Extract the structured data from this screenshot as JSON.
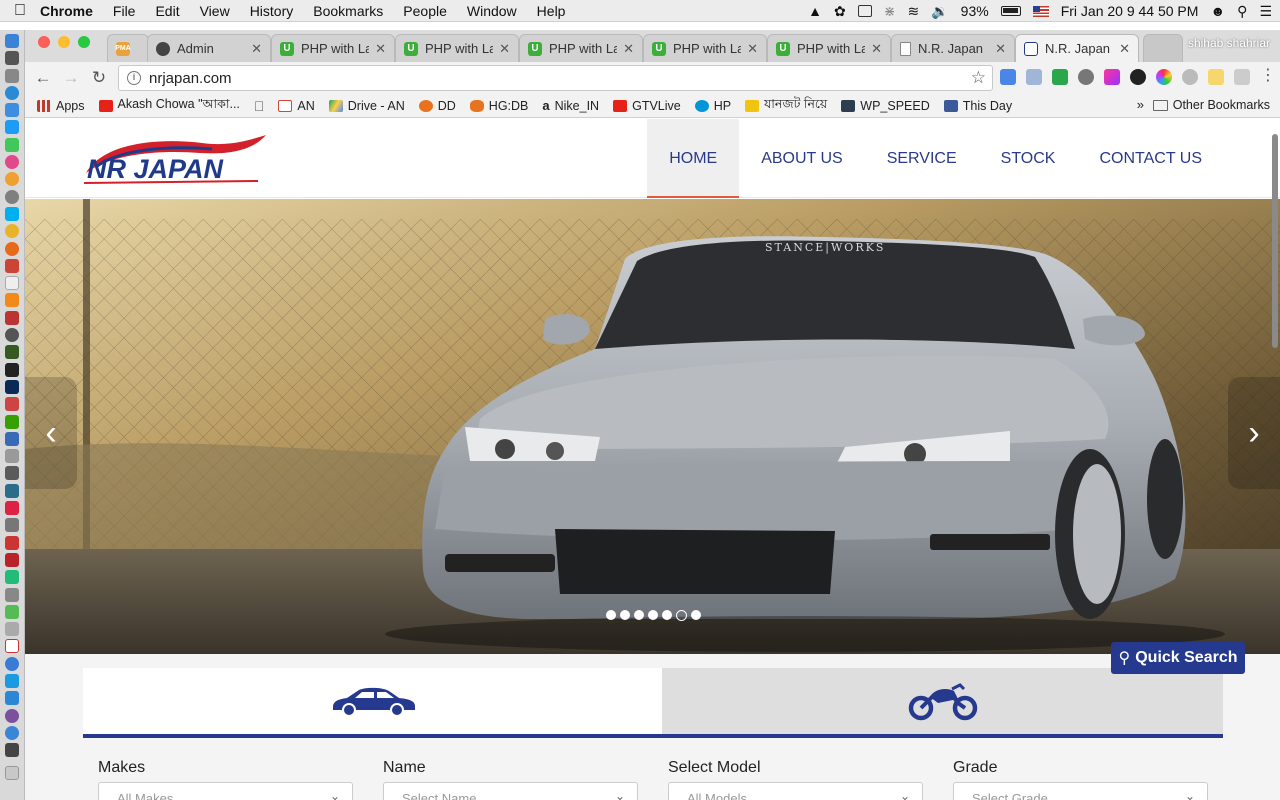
{
  "menubar": {
    "app": "Chrome",
    "items": [
      "File",
      "Edit",
      "View",
      "History",
      "Bookmarks",
      "People",
      "Window",
      "Help"
    ],
    "battery": "93%",
    "clock": "Fri Jan 20  9 44 50 PM"
  },
  "browser": {
    "tabs": [
      {
        "title": "",
        "favicon": "pma-icon",
        "color": "#e8a33c"
      },
      {
        "title": "Admin",
        "favicon": "github-icon",
        "color": "#444444"
      },
      {
        "title": "PHP with La",
        "favicon": "udemy-icon",
        "color": "#3cae3a"
      },
      {
        "title": "PHP with La",
        "favicon": "udemy-icon",
        "color": "#3cae3a"
      },
      {
        "title": "PHP with La",
        "favicon": "udemy-icon",
        "color": "#3cae3a"
      },
      {
        "title": "PHP with La",
        "favicon": "udemy-icon",
        "color": "#3cae3a"
      },
      {
        "title": "PHP with La",
        "favicon": "udemy-icon",
        "color": "#3cae3a"
      },
      {
        "title": "N.R. Japan",
        "favicon": "document-icon",
        "color": "#888888"
      },
      {
        "title": "N.R. Japan -",
        "favicon": "nrjapan-icon",
        "color": "#1f3a8a"
      }
    ],
    "profile_name": "shihab shahriar",
    "url": "nrjapan.com",
    "bookmarks": [
      {
        "label": "Apps",
        "icon": "apps-grid-icon",
        "color": "#c0392b"
      },
      {
        "label": "Akash Chowa \"আকা...",
        "icon": "youtube-icon",
        "color": "#e62117"
      },
      {
        "label": "",
        "icon": "apple-icon",
        "color": "#555555"
      },
      {
        "label": "AN",
        "icon": "gmail-icon",
        "color": "#d44638"
      },
      {
        "label": "Drive - AN",
        "icon": "drive-icon",
        "color": "#1fa463"
      },
      {
        "label": "DD",
        "icon": "dd-icon",
        "color": "#e8731f"
      },
      {
        "label": "HG:DB",
        "icon": "hg-icon",
        "color": "#e8731f"
      },
      {
        "label": "Nike_IN",
        "icon": "amazon-icon",
        "color": "#222222"
      },
      {
        "label": "GTVLive",
        "icon": "youtube-icon",
        "color": "#e62117"
      },
      {
        "label": "HP",
        "icon": "hp-icon",
        "color": "#0096d6"
      },
      {
        "label": "যানজট নিয়ে",
        "icon": "bookmark-icon",
        "color": "#f1c40f"
      },
      {
        "label": "WP_SPEED",
        "icon": "wp-speed-icon",
        "color": "#2c3e50"
      },
      {
        "label": "This Day",
        "icon": "facebook-icon",
        "color": "#3b5998"
      }
    ],
    "other_bookmarks": "Other Bookmarks"
  },
  "site": {
    "logo_text": "NR JAPAN",
    "nav": [
      {
        "label": "HOME",
        "active": true
      },
      {
        "label": "ABOUT US",
        "active": false
      },
      {
        "label": "SERVICE",
        "active": false
      },
      {
        "label": "STOCK",
        "active": false
      },
      {
        "label": "CONTACT US",
        "active": false
      }
    ],
    "hero": {
      "windshield_text": "STANCE|WORKS",
      "slide_count": 7,
      "active_slide": 6
    },
    "search": {
      "tabs": [
        {
          "name": "car-icon",
          "active": true
        },
        {
          "name": "motorcycle-icon",
          "active": false
        }
      ],
      "fields": [
        {
          "label": "Makes",
          "placeholder": "All Makes"
        },
        {
          "label": "Name",
          "placeholder": "Select Name"
        },
        {
          "label": "Select Model",
          "placeholder": "All Models"
        },
        {
          "label": "Grade",
          "placeholder": "Select Grade"
        }
      ],
      "quick_search": "Quick Search"
    },
    "colors": {
      "brand_blue": "#253a8e",
      "nav_text": "#2a3a8a",
      "active_underline": "#e05a3b",
      "logo_red": "#d4202a"
    }
  }
}
